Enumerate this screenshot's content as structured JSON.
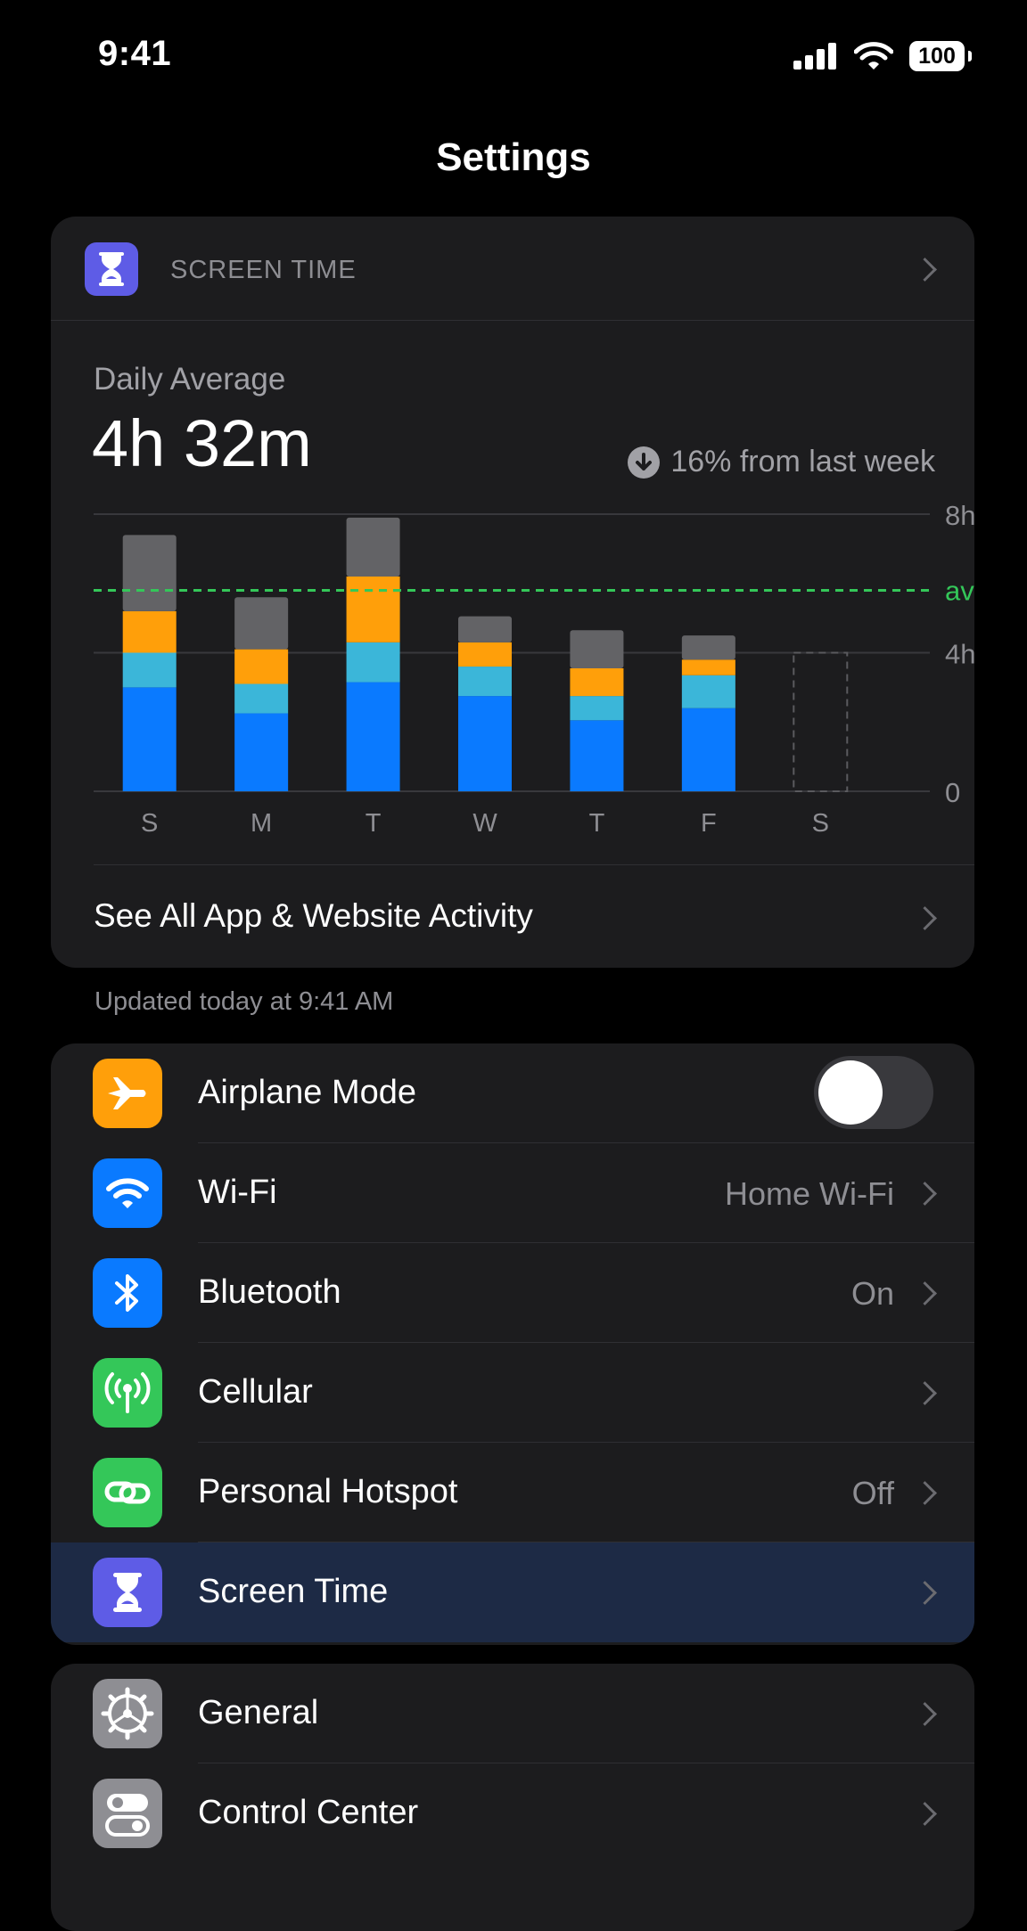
{
  "status_bar": {
    "time": "9:41",
    "battery": "100"
  },
  "nav": {
    "title": "Settings"
  },
  "screen_time_card": {
    "header_label": "SCREEN TIME",
    "daily_average_label": "Daily Average",
    "daily_average_value": "4h 32m",
    "trend_text": "16% from last week",
    "see_all_label": "See All App & Website Activity"
  },
  "chart_data": {
    "type": "bar",
    "stacked": true,
    "categories": [
      "S",
      "M",
      "T",
      "W",
      "T",
      "F",
      "S"
    ],
    "y_ticks": [
      "0",
      "4h",
      "8h"
    ],
    "ylim": [
      0,
      8
    ],
    "avg_label": "avg",
    "avg_value": 5.8,
    "series": [
      {
        "color": "#0a7aff",
        "values": [
          3.0,
          2.25,
          3.15,
          2.75,
          2.05,
          2.4,
          null
        ]
      },
      {
        "color": "#3bb6d9",
        "values": [
          1.0,
          0.85,
          1.15,
          0.85,
          0.7,
          0.95,
          null
        ]
      },
      {
        "color": "#ff9f0a",
        "values": [
          1.2,
          1.0,
          1.9,
          0.7,
          0.8,
          0.45,
          null
        ]
      },
      {
        "color": "#636366",
        "values": [
          2.2,
          1.5,
          1.7,
          0.75,
          1.1,
          0.7,
          null
        ]
      }
    ],
    "placeholder_value": 4.0,
    "grid": true
  },
  "updated_text": "Updated today at 9:41 AM",
  "rows_group_1": [
    {
      "label": "Airplane Mode",
      "icon": "airplane-icon",
      "color": "#ff9f0a",
      "toggle": false
    },
    {
      "label": "Wi-Fi",
      "icon": "wifi-icon",
      "color": "#0a7aff",
      "value": "Home Wi-Fi"
    },
    {
      "label": "Bluetooth",
      "icon": "bluetooth-icon",
      "color": "#0a7aff",
      "value": "On"
    },
    {
      "label": "Cellular",
      "icon": "antenna-icon",
      "color": "#34c759",
      "value": ""
    },
    {
      "label": "Personal Hotspot",
      "icon": "hotspot-link-icon",
      "color": "#34c759",
      "value": "Off"
    },
    {
      "label": "Screen Time",
      "icon": "hourglass-icon",
      "color": "#5e5ce6",
      "value": "",
      "selected": true
    }
  ],
  "rows_group_2": [
    {
      "label": "General",
      "icon": "gear-icon",
      "color": "#8e8e93"
    },
    {
      "label": "Control Center",
      "icon": "switches-icon",
      "color": "#8e8e93"
    }
  ]
}
